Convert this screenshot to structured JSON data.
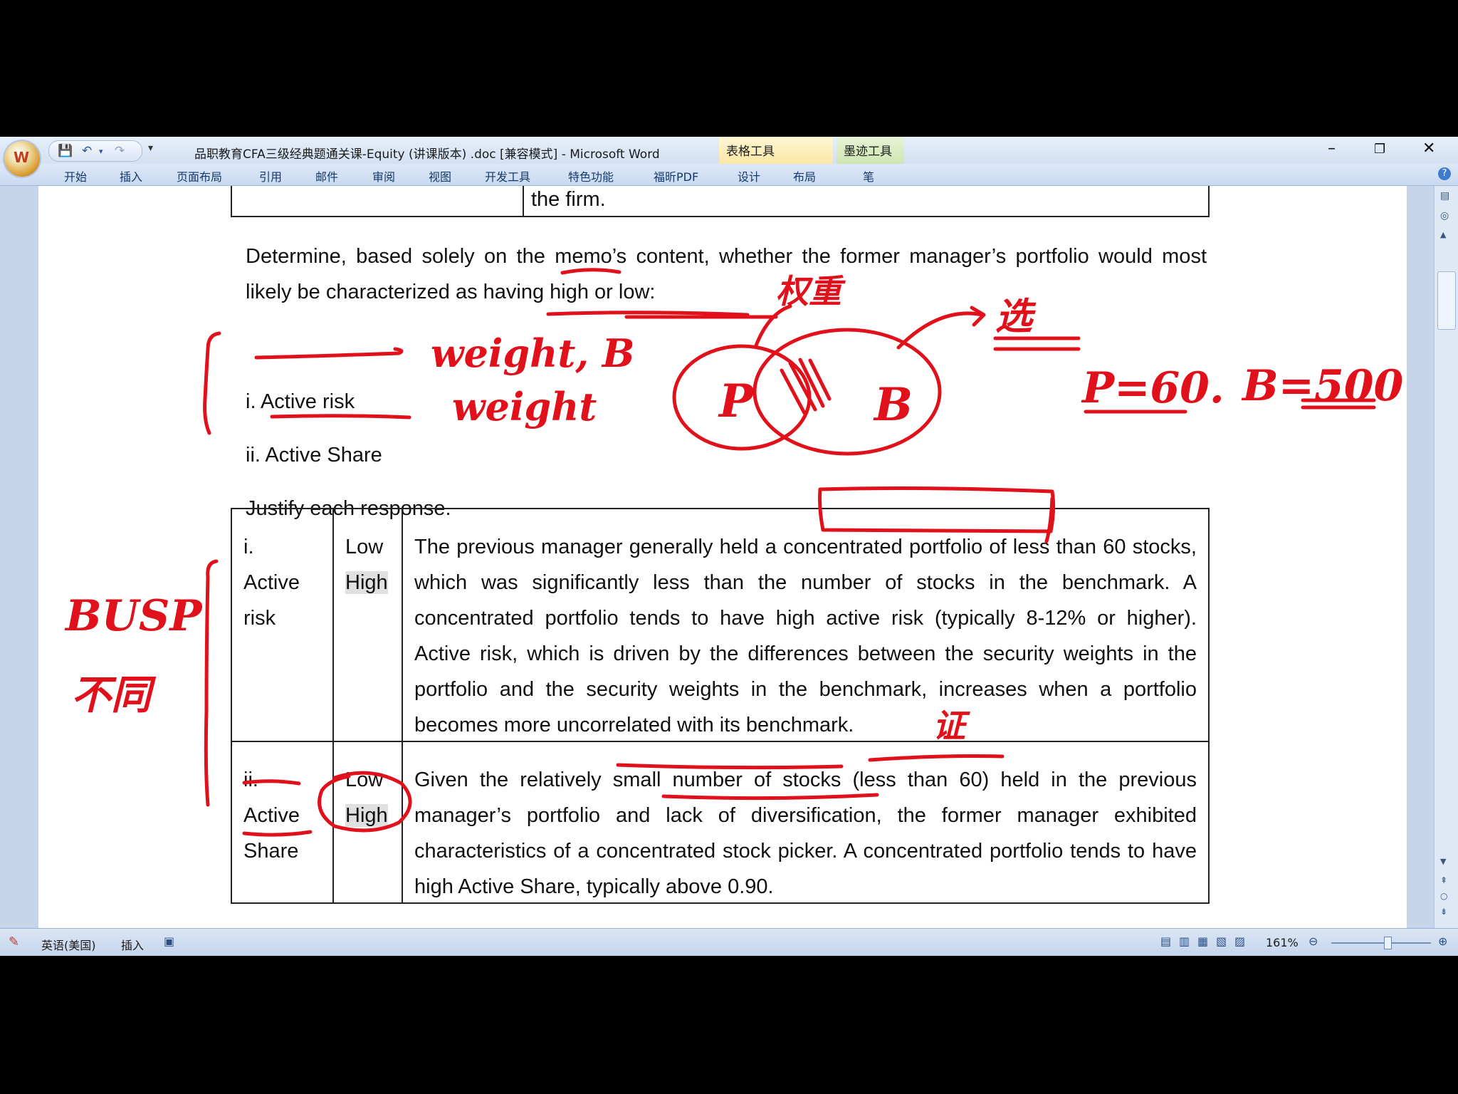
{
  "window": {
    "office_button_glyph": "W",
    "title": "品职教育CFA三级经典题通关课-Equity (讲课版本) .doc [兼容模式] - Microsoft Word",
    "context_tabs": [
      "表格工具",
      "墨迹工具"
    ],
    "controls": {
      "minimize": "–",
      "restore": "❐",
      "close": "✕"
    }
  },
  "ribbon_tabs": [
    "开始",
    "插入",
    "页面布局",
    "引用",
    "邮件",
    "审阅",
    "视图",
    "开发工具",
    "特色功能",
    "福昕PDF",
    "设计",
    "布局",
    "笔"
  ],
  "document": {
    "fragment_text": "the firm.",
    "question": "Determine, based solely on the memo’s content, whether the former manager’s portfolio would most likely be characterized as having high or low:",
    "item_i": "i. Active risk",
    "item_ii": "ii. Active Share",
    "justify": "Justify each response.",
    "rows": [
      {
        "label": [
          "i.",
          "Active",
          "risk"
        ],
        "options": [
          "Low",
          "High"
        ],
        "text": "The previous manager generally held a concentrated portfolio of less than 60 stocks, which was significantly less than the number of stocks in the benchmark. A concentrated portfolio tends to have high active risk (typically 8-12% or higher). Active risk, which is driven by the differences between the security weights in the portfolio and the security weights in the benchmark, increases when a portfolio becomes more uncorrelated with its benchmark."
      },
      {
        "label": [
          "ii.",
          "Active",
          "Share"
        ],
        "options": [
          "Low",
          "High"
        ],
        "text": "Given the relatively small number of stocks (less than 60) held in the previous manager’s portfolio and lack of diversification, the former manager exhibited characteristics of a concentrated stock picker. A concentrated portfolio tends to have high Active Share, typically above 0.90."
      }
    ]
  },
  "annotations": {
    "weight1": "weight, B",
    "weight2": "weight",
    "p": "P",
    "b": "B",
    "pc": "P=60.",
    "bc": "B=500",
    "busp": "BUSP",
    "cn1": "不同",
    "cn2": "证",
    "cn3": "选",
    "cn4": "权重"
  },
  "statusbar": {
    "language": "英语(美国)",
    "mode": "插入",
    "zoom": "161%"
  },
  "colors": {
    "ink": "#e0111a",
    "ribbon": "#c8d7ea"
  }
}
